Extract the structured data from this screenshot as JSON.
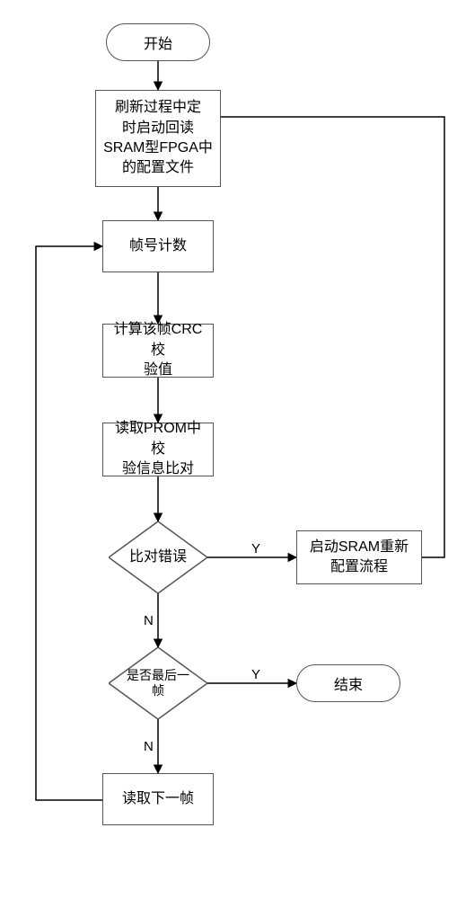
{
  "nodes": {
    "start": "开始",
    "step1": "刷新过程中定\n时启动回读\nSRAM型FPGA中\n的配置文件",
    "step2": "帧号计数",
    "step3": "计算该帧CRC校\n验值",
    "step4": "读取PROM中校\n验信息比对",
    "decision1": "比对错误",
    "step5": "启动SRAM重新\n配置流程",
    "decision2": "是否最后一\n帧",
    "end": "结束",
    "step6": "读取下一帧"
  },
  "edges": {
    "yes": "Y",
    "no": "N"
  }
}
